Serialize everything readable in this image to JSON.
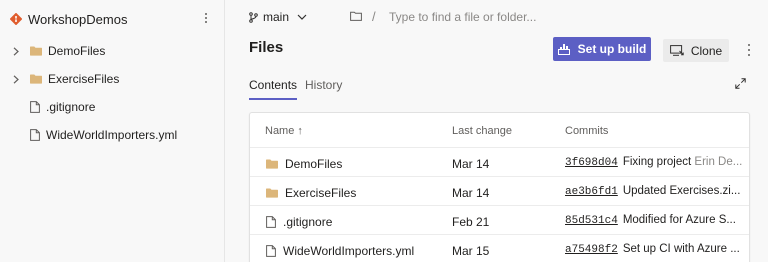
{
  "repo": {
    "name": "WorkshopDemos"
  },
  "sidebar": {
    "items": [
      {
        "label": "DemoFiles",
        "type": "folder"
      },
      {
        "label": "ExerciseFiles",
        "type": "folder"
      },
      {
        "label": ".gitignore",
        "type": "file"
      },
      {
        "label": "WideWorldImporters.yml",
        "type": "file"
      }
    ]
  },
  "topbar": {
    "branch": "main",
    "path_placeholder": "Type to find a file or folder..."
  },
  "page": {
    "title": "Files",
    "setup_build_label": "Set up build",
    "clone_label": "Clone"
  },
  "tabs": [
    {
      "label": "Contents",
      "active": true
    },
    {
      "label": "History",
      "active": false
    }
  ],
  "table": {
    "columns": [
      "Name ↑",
      "Last change",
      "Commits"
    ],
    "rows": [
      {
        "name": "DemoFiles",
        "type": "folder",
        "last_change": "Mar 14",
        "hash": "3f698d04",
        "message": "Fixing project",
        "author": "Erin De..."
      },
      {
        "name": "ExerciseFiles",
        "type": "folder",
        "last_change": "Mar 14",
        "hash": "ae3b6fd1",
        "message": "Updated Exercises.zi...",
        "author": ""
      },
      {
        "name": ".gitignore",
        "type": "file",
        "last_change": "Feb 21",
        "hash": "85d531c4",
        "message": "Modified for Azure S...",
        "author": ""
      },
      {
        "name": "WideWorldImporters.yml",
        "type": "file",
        "last_change": "Mar 15",
        "hash": "a75498f2",
        "message": "Set up CI with Azure ...",
        "author": ""
      }
    ]
  },
  "colors": {
    "accent": "#5c5fc4",
    "folder": "#dcb67a",
    "repo_icon": "#e05d2e"
  }
}
